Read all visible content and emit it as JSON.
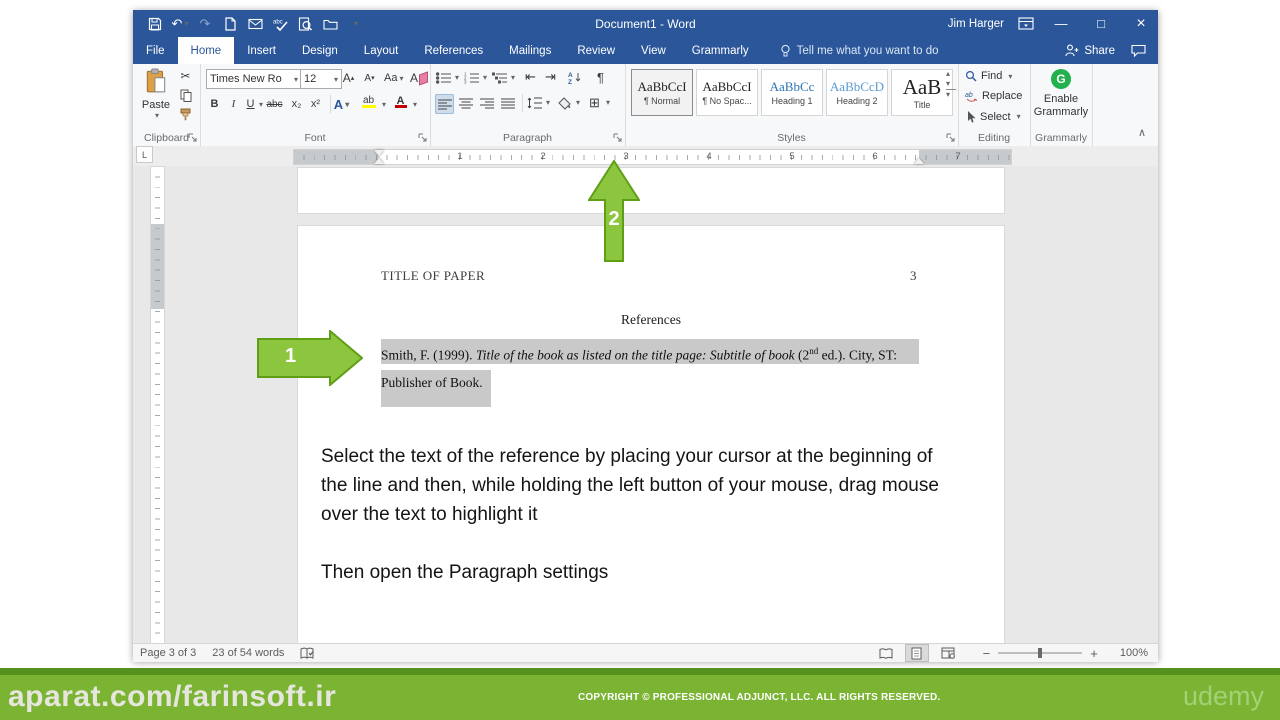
{
  "titlebar": {
    "title": "Document1  -  Word",
    "user": "Jim Harger"
  },
  "window_controls": {
    "minimize": "—",
    "maximize": "□",
    "close": "×"
  },
  "tabs": {
    "items": [
      "File",
      "Home",
      "Insert",
      "Design",
      "Layout",
      "References",
      "Mailings",
      "Review",
      "View",
      "Grammarly"
    ],
    "active": "Home"
  },
  "search": {
    "tell_me": "Tell me what you want to do"
  },
  "share": {
    "label": "Share"
  },
  "icons": {
    "dropdown": "▾",
    "up_small": "▴",
    "undo": "↶",
    "redo": "↷",
    "cut": "✂",
    "pilcrow": "¶",
    "collapse": "∧",
    "outdent": "⇤",
    "indent": "⇥",
    "borders_grid": "⊞",
    "scroll_up": "▴",
    "scroll_down": "▾",
    "gallery_more": "▾"
  },
  "ribbon": {
    "clipboard": {
      "group_label": "Clipboard",
      "paste": "Paste"
    },
    "font": {
      "group_label": "Font",
      "name": "Times New Ro",
      "size": "12",
      "bold": "B",
      "italic": "I",
      "underline": "U",
      "strikethrough": "abc",
      "subscript": "x₂",
      "superscript": "x²",
      "change_case": "Aa",
      "grow_font": "A",
      "shrink_font": "A",
      "clear_format": "A",
      "text_effects": "A",
      "highlight": "ab",
      "font_color": "A"
    },
    "paragraph": {
      "group_label": "Paragraph",
      "show_marks": "¶"
    },
    "styles": {
      "group_label": "Styles",
      "items": [
        {
          "preview": "AaBbCcI",
          "name": "¶ Normal"
        },
        {
          "preview": "AaBbCcI",
          "name": "¶ No Spac..."
        },
        {
          "preview": "AaBbCc",
          "name": "Heading 1"
        },
        {
          "preview": "AaBbCcD",
          "name": "Heading 2"
        },
        {
          "preview": "AaB",
          "name": "Title"
        }
      ]
    },
    "editing": {
      "group_label": "Editing",
      "find": "Find",
      "replace": "Replace",
      "select": "Select"
    },
    "grammarly_group": {
      "group_label": "Grammarly",
      "enable_line1": "Enable",
      "enable_line2": "Grammarly",
      "logo": "G"
    }
  },
  "ruler": {
    "tab_selector": "L",
    "numbers": [
      "1",
      "2",
      "3",
      "4",
      "5",
      "6",
      "7"
    ]
  },
  "document": {
    "running_head": "TITLE OF PAPER",
    "page_number": "3",
    "heading": "References",
    "reference": {
      "pre": "Smith, F. (1999). ",
      "italic": "Title of the book as listed on the title page: Subtitle of book",
      "mid": " (2",
      "sup": "nd",
      "post": " ed.). City, ST:",
      "line2": "Publisher of Book."
    },
    "instruction1": "Select the text of the reference by placing your cursor at the beginning of the line and then, while holding the left button of your mouse, drag mouse over the text to highlight it",
    "instruction2": "Then open the Paragraph settings"
  },
  "callouts": {
    "step1": "1",
    "step2": "2"
  },
  "statusbar": {
    "page_info": "Page 3 of 3",
    "word_count": "23 of 54 words",
    "zoom": "100%",
    "zoom_out": "−",
    "zoom_in": "+"
  },
  "footer": {
    "watermark": "aparat.com/farinsoft.ir",
    "copyright": "COPYRIGHT © PROFESSIONAL ADJUNCT, LLC. ALL RIGHTS RESERVED.",
    "brand": "udemy"
  },
  "colors": {
    "titlebar_blue": "#2b579a",
    "arrow_green": "#8cc63e",
    "arrow_border": "#5f9e16",
    "footer_green": "#7ab432",
    "footer_stripe": "#55911d",
    "selection_gray": "#c9c9c9",
    "grammarly_green": "#22b14c"
  }
}
